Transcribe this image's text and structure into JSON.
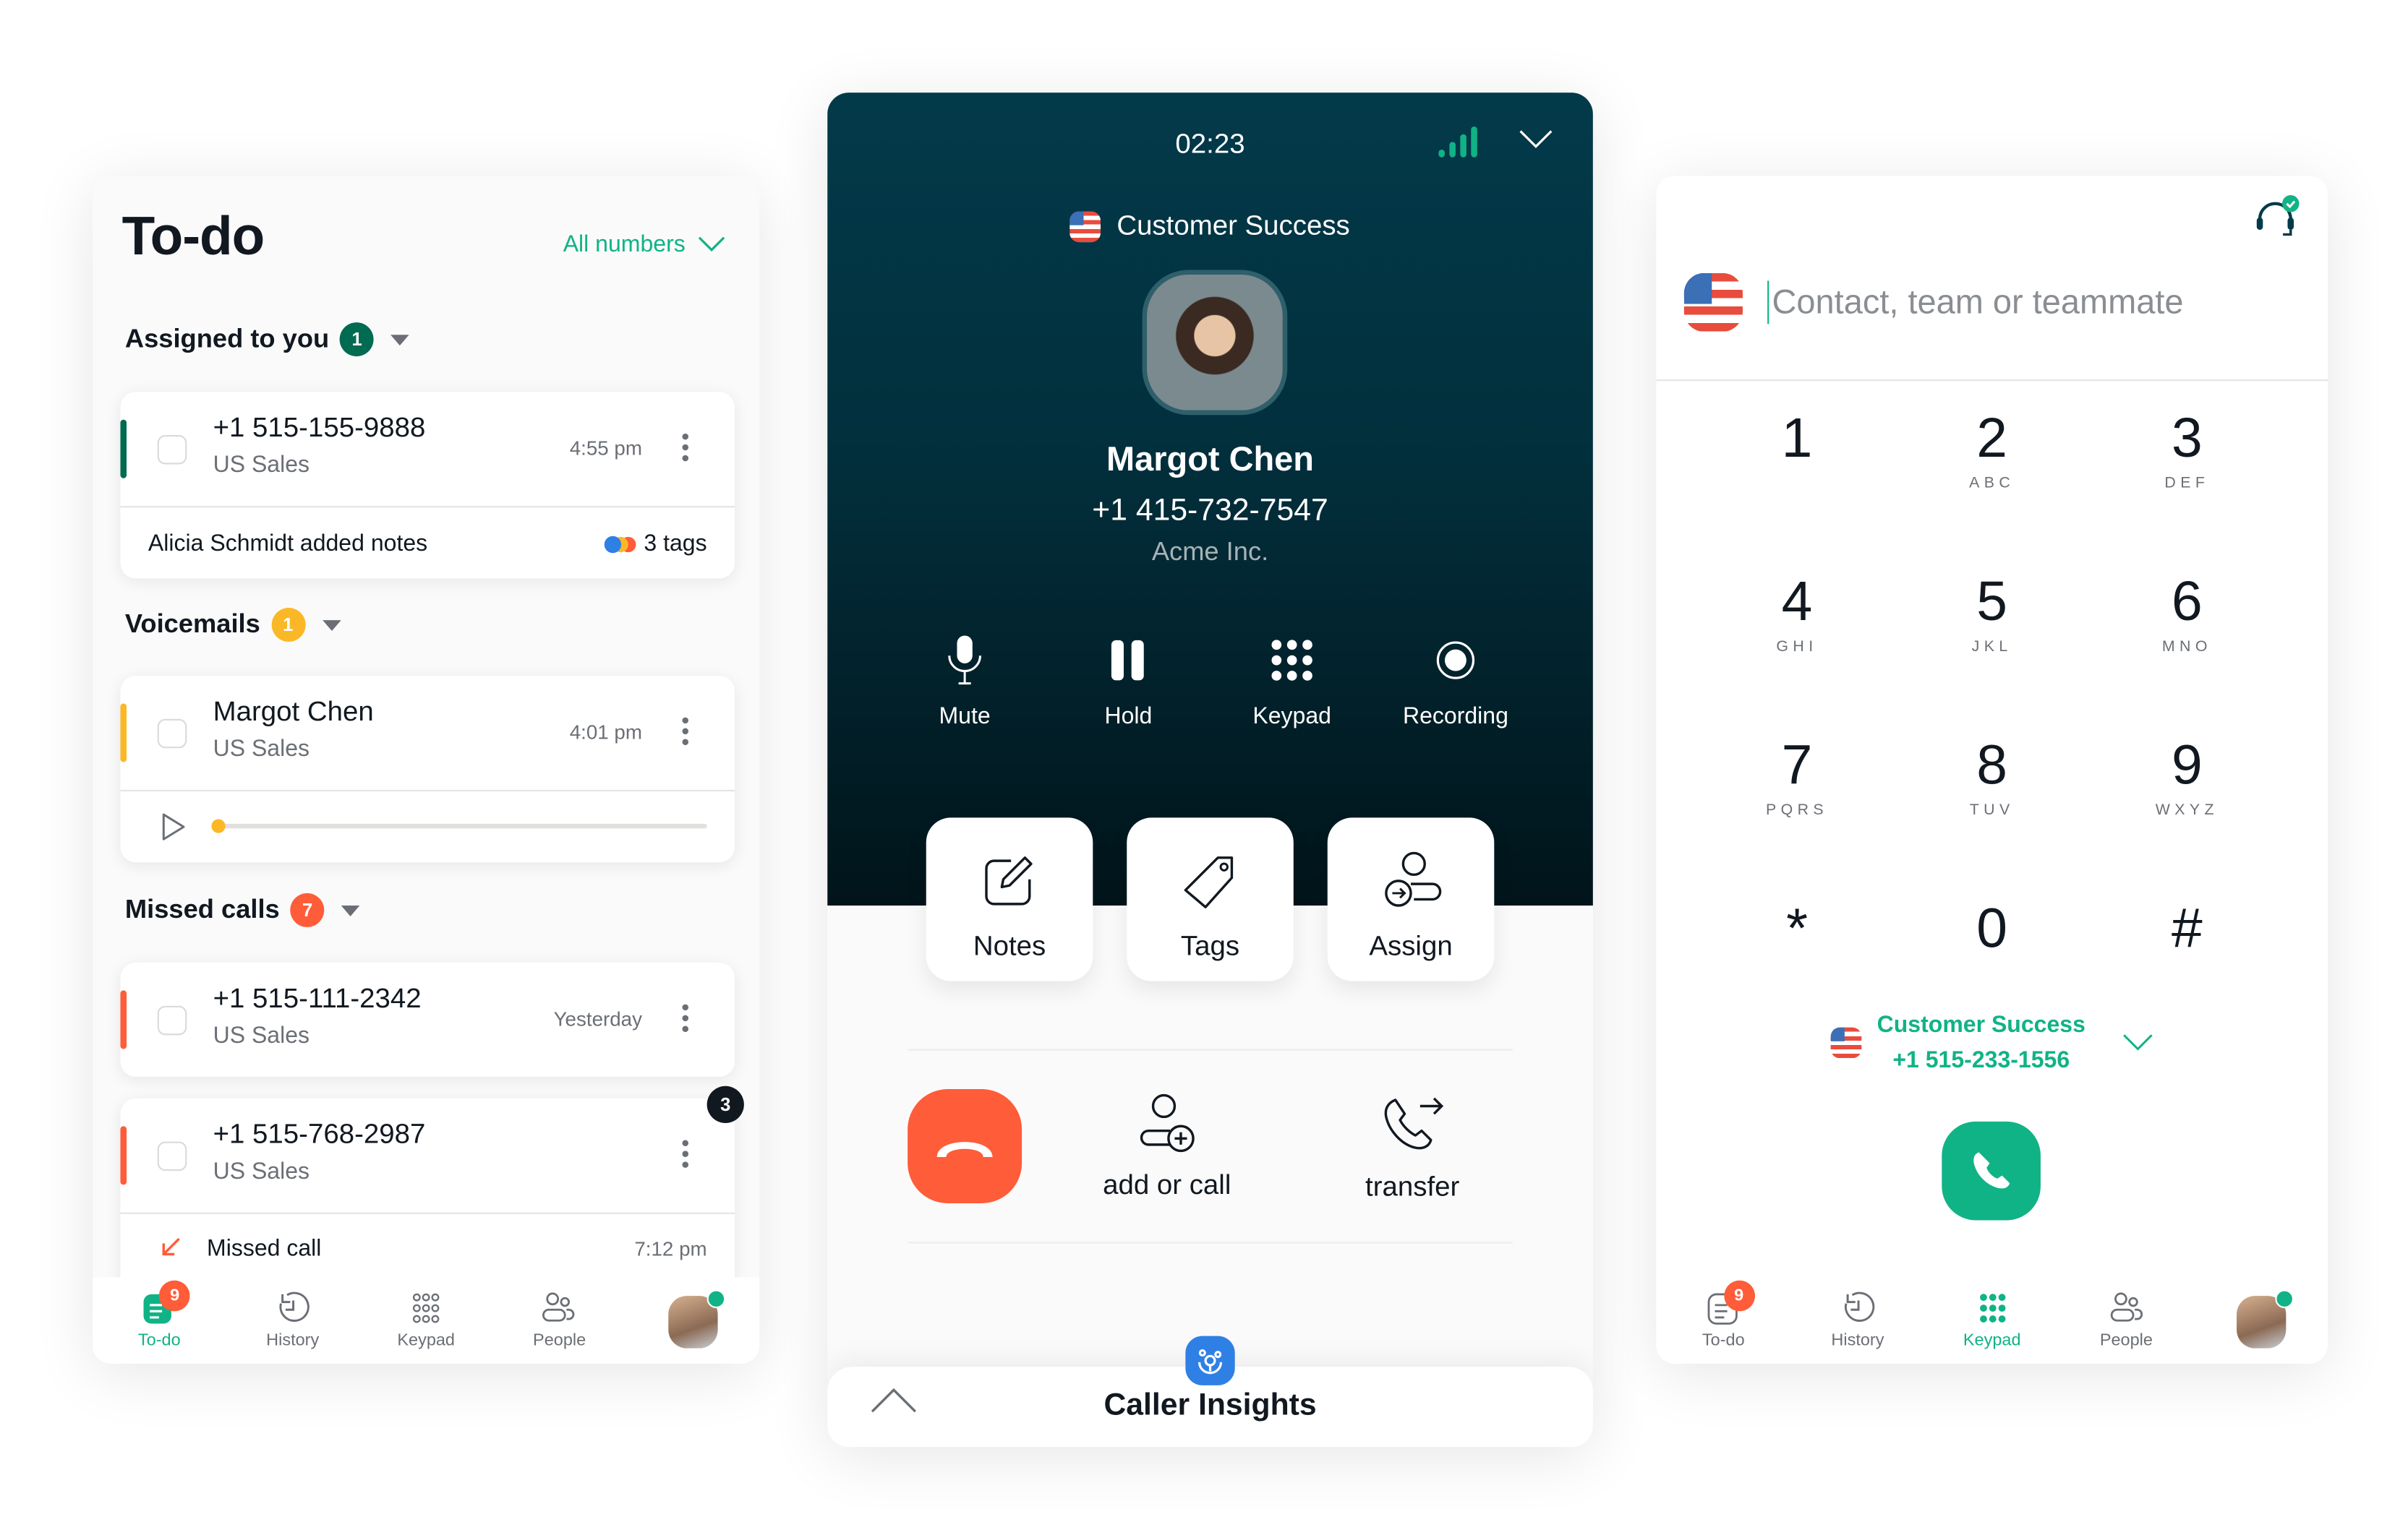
{
  "todo": {
    "title": "To-do",
    "number_filter": "All numbers",
    "sections": {
      "assigned": {
        "label": "Assigned to you",
        "count": "1",
        "color": "#006b51"
      },
      "voicemails": {
        "label": "Voicemails",
        "count": "1",
        "color": "#fbb826"
      },
      "missed": {
        "label": "Missed calls",
        "count": "7",
        "color": "#ff5c39"
      }
    },
    "assigned_item": {
      "number": "+1 515-155-9888",
      "line": "US Sales",
      "time": "4:55 pm",
      "note": "Alicia Schmidt added notes",
      "tags": "3 tags"
    },
    "voicemail_item": {
      "name": "Margot Chen",
      "line": "US Sales",
      "time": "4:01 pm",
      "progress": 0
    },
    "missed_items": [
      {
        "number": "+1 515-111-2342",
        "line": "US Sales",
        "time": "Yesterday"
      },
      {
        "number": "+1 515-768-2987",
        "line": "US Sales",
        "count": "3",
        "detail": "Missed call",
        "detail_time": "7:12 pm"
      }
    ]
  },
  "tabbar_left": {
    "items": [
      {
        "label": "To-do",
        "badge": "9",
        "active": true
      },
      {
        "label": "History"
      },
      {
        "label": "Keypad"
      },
      {
        "label": "People"
      }
    ]
  },
  "call": {
    "timer": "02:23",
    "line": "Customer Success",
    "contact_name": "Margot Chen",
    "contact_phone": "+1 415-732-7547",
    "company": "Acme Inc.",
    "controls": [
      "Mute",
      "Hold",
      "Keypad",
      "Recording"
    ],
    "actions": [
      "Notes",
      "Tags",
      "Assign"
    ],
    "add_or_call": "add or call",
    "transfer": "transfer",
    "insights_label": "Caller Insights"
  },
  "dialer": {
    "search_placeholder": "Contact, team or teammate",
    "keys": [
      {
        "d": "1",
        "l": ""
      },
      {
        "d": "2",
        "l": "ABC"
      },
      {
        "d": "3",
        "l": "DEF"
      },
      {
        "d": "4",
        "l": "GHI"
      },
      {
        "d": "5",
        "l": "JKL"
      },
      {
        "d": "6",
        "l": "MNO"
      },
      {
        "d": "7",
        "l": "PQRS"
      },
      {
        "d": "8",
        "l": "TUV"
      },
      {
        "d": "9",
        "l": "WXYZ"
      },
      {
        "d": "*",
        "l": ""
      },
      {
        "d": "0",
        "l": ""
      },
      {
        "d": "#",
        "l": ""
      }
    ],
    "from_line": "Customer Success",
    "from_number": "+1 515-233-1556"
  },
  "tabbar_right": {
    "items": [
      {
        "label": "To-do",
        "badge": "9"
      },
      {
        "label": "History"
      },
      {
        "label": "Keypad",
        "active": true
      },
      {
        "label": "People"
      }
    ]
  },
  "colors": {
    "brand_green": "#10b386",
    "danger": "#ff5c39",
    "dark_teal": "#033a4a",
    "insights_blue": "#2f80e4"
  }
}
